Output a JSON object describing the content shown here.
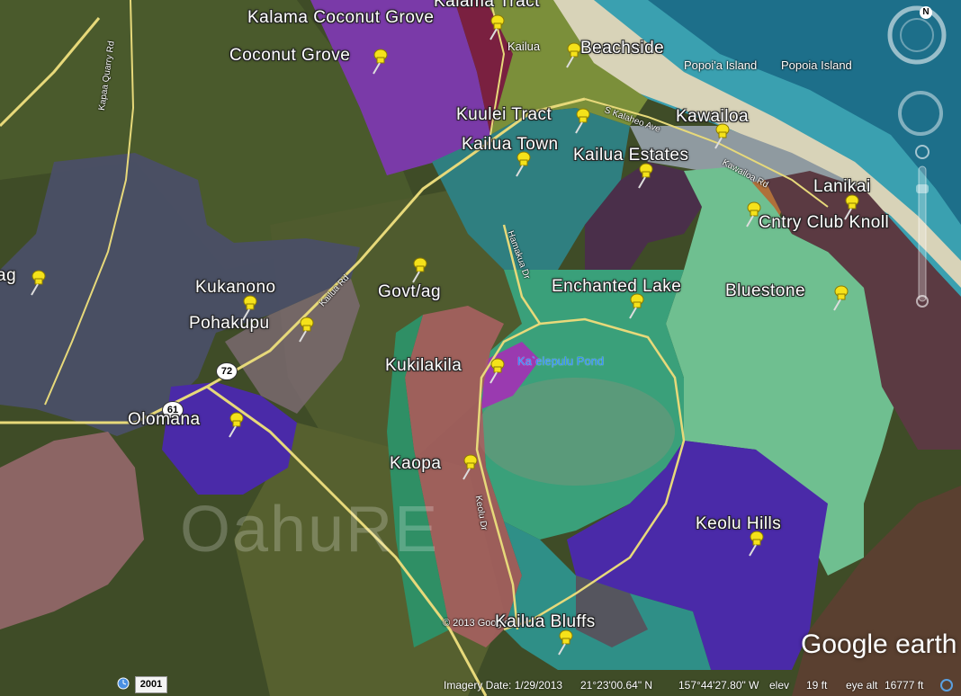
{
  "places": [
    {
      "label": "Kalama Coconut Grove"
    },
    {
      "label": "Kalama Tract"
    },
    {
      "label": "Coconut Grove"
    },
    {
      "label": "Beachside"
    },
    {
      "label": "Kuulei Tract"
    },
    {
      "label": "Kawailoa"
    },
    {
      "label": "Kailua Town"
    },
    {
      "label": "Kailua Estates"
    },
    {
      "label": "Lanikai"
    },
    {
      "label": "Cntry Club Knoll"
    },
    {
      "label": "Kukanono"
    },
    {
      "label": "Govt/ag"
    },
    {
      "label": "Enchanted Lake"
    },
    {
      "label": "Bluestone"
    },
    {
      "label": "Pohakupu"
    },
    {
      "label": "Kukilakila"
    },
    {
      "label": "Olomana"
    },
    {
      "label": "Kaopa"
    },
    {
      "label": "Keolu Hills"
    },
    {
      "label": "Kailua Bluffs"
    },
    {
      "label": "ag"
    }
  ],
  "map_text": {
    "kailua": "Kailua",
    "popoia1": "Popoi'a Island",
    "popoia2": "Popoia Island",
    "pond": "Ka`elepulu Pond",
    "copyright": "© 2013 Google",
    "watermark": "OahuRE"
  },
  "roads": {
    "kapaa": "Kapaa Quarry Rd",
    "kailua_rd": "Kailua Rd",
    "hamakua": "Hamakua Dr",
    "kalaheo": "S Kalaheo Ave",
    "kawailoa": "Kawailoa Rd",
    "keolu": "Keolu Dr",
    "r72": "72",
    "r61": "61"
  },
  "statusbar": {
    "year": "2001",
    "imagery": "Imagery Date: 1/29/2013",
    "lat": "21°23'00.64\" N",
    "lon": "157°44'27.80\" W",
    "elev_label": "elev",
    "elev": "19 ft",
    "eye_label": "eye alt",
    "eye": "16777 ft"
  },
  "logo": {
    "google": "Google",
    "earth": "earth"
  },
  "nav": {
    "north": "N"
  },
  "colors": {
    "purple": "#8a3fb0",
    "indigo": "#4a2aa8",
    "teal": "#2f8f87",
    "pin": "#f5e21a"
  }
}
